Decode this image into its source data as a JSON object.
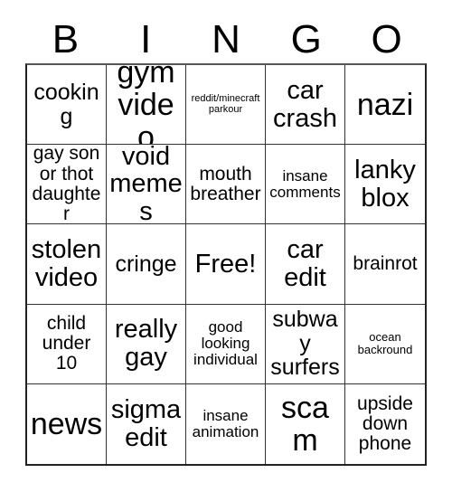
{
  "header": {
    "letters": [
      "B",
      "I",
      "N",
      "G",
      "O"
    ]
  },
  "grid": {
    "rows": [
      [
        {
          "text": "cooking",
          "size": "t-md"
        },
        {
          "text": "gym video",
          "size": "t-xl"
        },
        {
          "text": "reddit/minecraft parkour",
          "size": "t-tiny"
        },
        {
          "text": "car crash",
          "size": "t-lg"
        },
        {
          "text": "nazi",
          "size": "t-xl"
        }
      ],
      [
        {
          "text": "gay son or thot daughter",
          "size": "t-sm"
        },
        {
          "text": "void memes",
          "size": "t-lg"
        },
        {
          "text": "mouth breather",
          "size": "t-sm"
        },
        {
          "text": "insane comments",
          "size": "t-xs"
        },
        {
          "text": "lanky blox",
          "size": "t-lg"
        }
      ],
      [
        {
          "text": "stolen video",
          "size": "t-lg"
        },
        {
          "text": "cringe",
          "size": "t-md"
        },
        {
          "text": "Free!",
          "size": "t-lg"
        },
        {
          "text": "car edit",
          "size": "t-lg"
        },
        {
          "text": "brainrot",
          "size": "t-sm"
        }
      ],
      [
        {
          "text": "child under 10",
          "size": "t-sm"
        },
        {
          "text": "really gay",
          "size": "t-lg"
        },
        {
          "text": "good looking individual",
          "size": "t-xs"
        },
        {
          "text": "subway surfers",
          "size": "t-md"
        },
        {
          "text": "ocean backround",
          "size": "t-xxs"
        }
      ],
      [
        {
          "text": "news",
          "size": "t-xl"
        },
        {
          "text": "sigma edit",
          "size": "t-lg"
        },
        {
          "text": "insane animation",
          "size": "t-xs"
        },
        {
          "text": "scam",
          "size": "t-xl"
        },
        {
          "text": "upside down phone",
          "size": "t-sm"
        }
      ]
    ]
  },
  "colors": {
    "background": "#ffffff",
    "text": "#000000",
    "grid_line": "#333333",
    "grid_border": "#222222"
  }
}
